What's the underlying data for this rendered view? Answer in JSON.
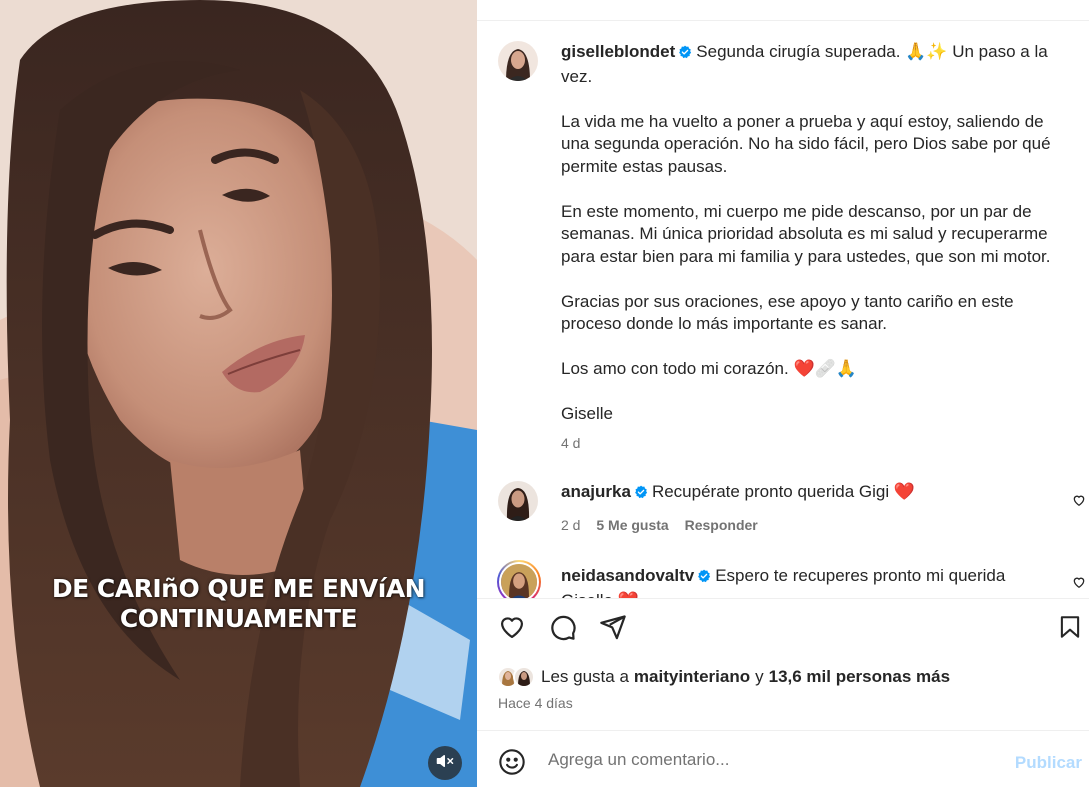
{
  "media": {
    "caption_line1": "DE CARIñO QUE ME ENVíAN",
    "caption_line2": "CONTINUAMENTE"
  },
  "post": {
    "author": "giselleblondet",
    "first_line": "Segunda cirugía superada. 🙏✨ Un paso a la vez.",
    "paragraphs": [
      "La vida me ha vuelto a poner a prueba y aquí estoy, saliendo de una segunda operación. No ha sido fácil, pero Dios sabe por qué permite estas pausas.",
      "En este momento, mi cuerpo me pide descanso, por un par de semanas. Mi única prioridad absoluta es mi salud y recuperarme para estar bien para mi familia y para ustedes, que son mi motor.",
      "Gracias por sus oraciones, ese apoyo y tanto cariño en este proceso donde lo más importante es sanar.",
      "Los amo con todo mi corazón. ❤️🩹🙏",
      "Giselle"
    ],
    "age": "4 d"
  },
  "comments": [
    {
      "user": "anajurka",
      "text": "Recupérate pronto querida Gigi ❤️",
      "age": "2 d",
      "likes": "5 Me gusta",
      "reply": "Responder"
    },
    {
      "user": "neidasandovaltv",
      "text": "Espero te recuperes pronto mi querida Giselle ❤️"
    }
  ],
  "likes": {
    "prefix": "Les gusta a",
    "user": "maityinteriano",
    "connector": "y",
    "others": "13,6 mil personas más"
  },
  "date": "Hace 4 días",
  "add_comment": {
    "placeholder": "Agrega un comentario...",
    "publish": "Publicar"
  },
  "colors": {
    "verified": "#0095f6",
    "publish_disabled": "#b3dbff",
    "heart": "#e0245e"
  },
  "icons": [
    "volume-off-icon",
    "heart-icon",
    "comment-icon",
    "share-icon",
    "bookmark-icon",
    "emoji-icon",
    "verified-badge-icon"
  ]
}
